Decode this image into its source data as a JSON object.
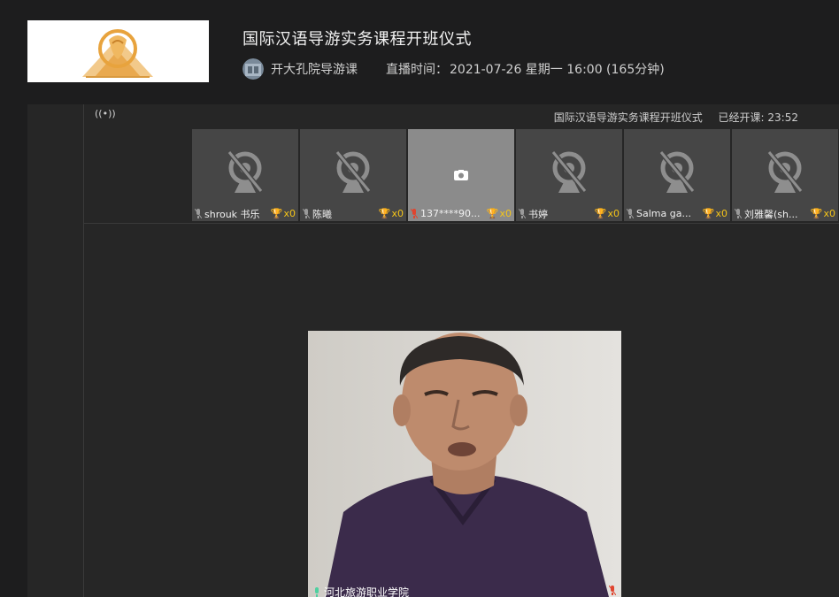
{
  "course": {
    "title": "国际汉语导游实务课程开班仪式",
    "teacher_name": "开大孔院导游课",
    "broadcast_label": "直播时间：",
    "broadcast_value": "2021-07-26 星期一 16:00 (165分钟)"
  },
  "classroom": {
    "live_icon": "((•))",
    "class_name": "国际汉语导游实务课程开班仪式",
    "elapsed_label": "已经开课:",
    "elapsed_value": "23:52"
  },
  "participants": [
    {
      "name": "shrouk 书乐",
      "trophies": "x0",
      "camera": "off",
      "mic": "muted"
    },
    {
      "name": "陈曦",
      "trophies": "x0",
      "camera": "off",
      "mic": "muted"
    },
    {
      "name": "137****90...",
      "trophies": "x0",
      "camera": "paused",
      "mic": "muted-red"
    },
    {
      "name": "书婷",
      "trophies": "x0",
      "camera": "off",
      "mic": "muted"
    },
    {
      "name": "Salma ga...",
      "trophies": "x0",
      "camera": "off",
      "mic": "muted"
    },
    {
      "name": "刘雅馨(sh...",
      "trophies": "x0",
      "camera": "off",
      "mic": "muted"
    }
  ],
  "main_video": {
    "label": "河北旅游职业学院"
  },
  "colors": {
    "background": "#1d1d1e",
    "tile": "#464646",
    "tile_highlight": "#8b8b8b",
    "trophy": "#f5c518",
    "mic_muted_red": "#e0452f"
  },
  "icons": {
    "logo": "confucius-institute-logo",
    "live": "broadcast-icon",
    "camera_off": "camera-off-icon",
    "mic": "mic-icon",
    "trophy": "trophy-icon"
  }
}
